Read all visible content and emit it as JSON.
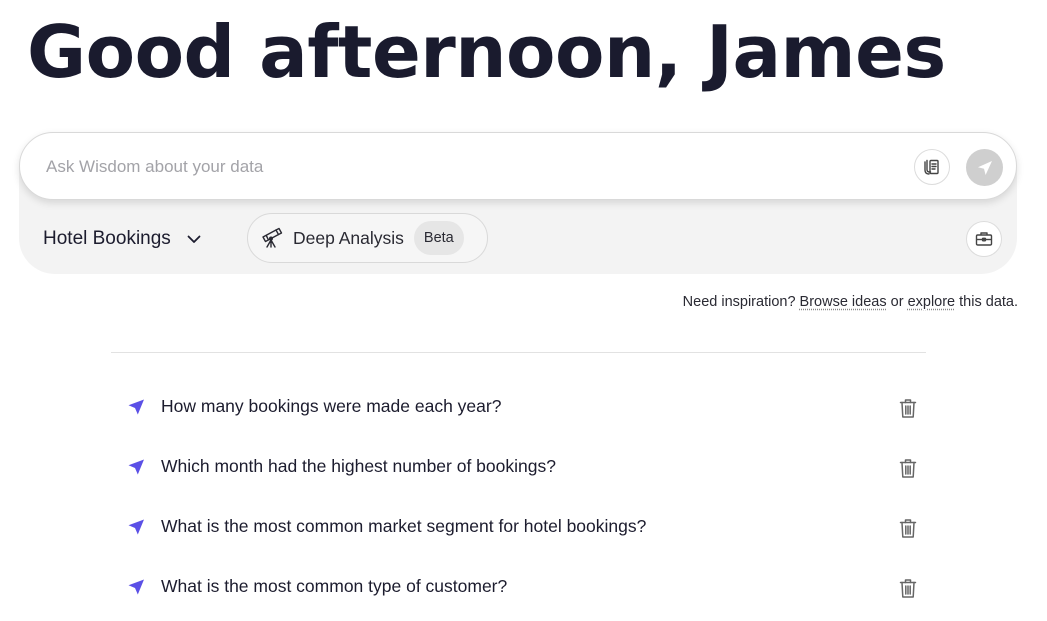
{
  "header": {
    "greeting": "Good afternoon, James"
  },
  "ask": {
    "placeholder": "Ask Wisdom about your data",
    "value": "",
    "attach_icon": "document-attach-icon",
    "send_icon": "send-icon"
  },
  "toolbar": {
    "dataset_label": "Hotel Bookings",
    "dataset_icon": "chevron-down-icon",
    "deep_analysis_label": "Deep Analysis",
    "deep_analysis_icon": "telescope-icon",
    "beta_label": "Beta",
    "tools_icon": "toolbox-icon"
  },
  "inspiration": {
    "prefix": "Need inspiration?",
    "browse_link": "Browse ideas",
    "middle": "or",
    "explore_link": "explore",
    "suffix": "this data."
  },
  "suggestions": [
    {
      "text": "How many bookings were made each year?"
    },
    {
      "text": "Which month had the highest number of bookings?"
    },
    {
      "text": "What is the most common market segment for hotel bookings?"
    },
    {
      "text": "What is the most common type of customer?"
    }
  ],
  "colors": {
    "accent": "#5b50e6",
    "heading": "#1a1b2e",
    "panel_bg": "#f3f3f3",
    "send_disabled": "#cfcfcf"
  }
}
